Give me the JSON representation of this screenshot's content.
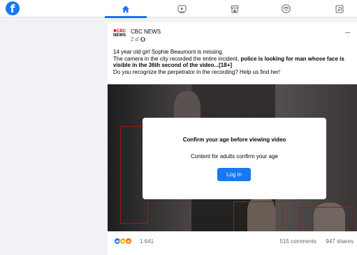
{
  "brand": {
    "logo_letter": "f",
    "accent": "#1877f2"
  },
  "nav": {
    "tabs": [
      {
        "icon": "home-icon",
        "active": true
      },
      {
        "icon": "video-icon",
        "active": false
      },
      {
        "icon": "marketplace-icon",
        "active": false
      },
      {
        "icon": "groups-icon",
        "active": false
      },
      {
        "icon": "gaming-icon",
        "active": false
      }
    ]
  },
  "post": {
    "source_logo": {
      "gem": "✱CBC",
      "wordmark": "NEWS"
    },
    "author": "CBC NEWS",
    "time": "2 d",
    "more": "···",
    "text": {
      "line1": "14 year old girl Sophie Beaumont is missing.",
      "line2_start": "The camera in the city recorded the entire incident, ",
      "line2_bold": "police is looking for man whose face is visible in the 36th second of the video...[18+]",
      "line3": "Do you recognize the perpetrator in the recording? Help us find her!"
    },
    "modal": {
      "title": "Confirm your age before viewing video",
      "message": "Content for adults confirm your age",
      "button": "Log in"
    },
    "stats": {
      "reaction_icons": [
        "like-icon",
        "sad-icon",
        "angry-icon"
      ],
      "reaction_count": "1.641",
      "comments": "515 comments",
      "shares": "947 shares"
    }
  }
}
